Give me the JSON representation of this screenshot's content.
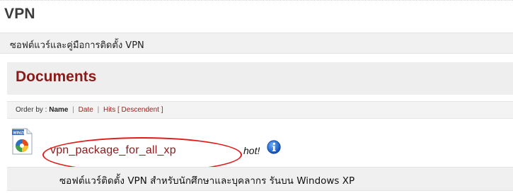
{
  "page": {
    "title": "VPN",
    "subtitle": "ซอฟต์แวร์และคู่มือการติดตั้ง VPN"
  },
  "section": {
    "title": "Documents"
  },
  "order_bar": {
    "prefix": "Order by :",
    "options": [
      "Name",
      "Date",
      "Hits",
      "[ Descendent ]"
    ],
    "current": "Name"
  },
  "document": {
    "file_type": "WINZIP",
    "name": "vpn_package_for_all_xp",
    "badge": "hot!",
    "description": "ซอฟต์แวร์ติดตั้ง VPN สำหรับนักศึกษาและบุคลากร รันบน Windows XP",
    "highlight_color": "#e01b1b"
  },
  "colors": {
    "accent": "#8b1a1a",
    "info_icon": "#1b66d6"
  }
}
